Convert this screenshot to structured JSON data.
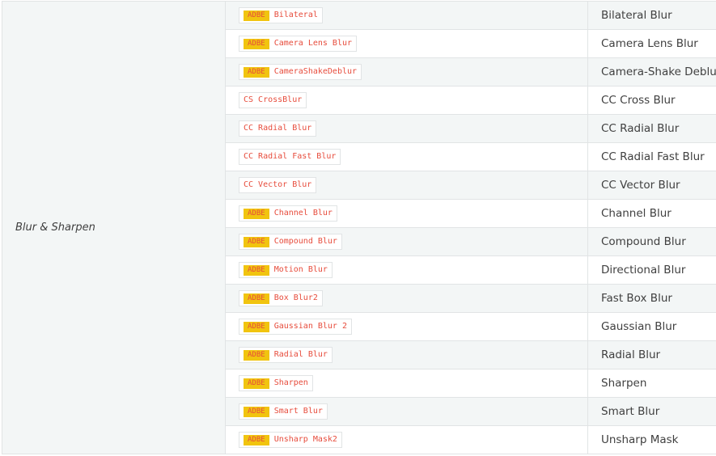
{
  "category": "Blur & Sharpen",
  "rows": [
    {
      "badge": "ADBE",
      "match": "Bilateral",
      "name": "Bilateral Blur"
    },
    {
      "badge": "ADBE",
      "match": "Camera Lens Blur",
      "name": "Camera Lens Blur"
    },
    {
      "badge": "ADBE",
      "match": "CameraShakeDeblur",
      "name": "Camera-Shake Deblur"
    },
    {
      "badge": "",
      "match": "CS CrossBlur",
      "name": "CC Cross Blur"
    },
    {
      "badge": "",
      "match": "CC Radial Blur",
      "name": "CC Radial Blur"
    },
    {
      "badge": "",
      "match": "CC Radial Fast Blur",
      "name": "CC Radial Fast Blur"
    },
    {
      "badge": "",
      "match": "CC Vector Blur",
      "name": "CC Vector Blur"
    },
    {
      "badge": "ADBE",
      "match": "Channel Blur",
      "name": "Channel Blur"
    },
    {
      "badge": "ADBE",
      "match": "Compound Blur",
      "name": "Compound Blur"
    },
    {
      "badge": "ADBE",
      "match": "Motion Blur",
      "name": "Directional Blur"
    },
    {
      "badge": "ADBE",
      "match": "Box Blur2",
      "name": "Fast Box Blur"
    },
    {
      "badge": "ADBE",
      "match": "Gaussian Blur 2",
      "name": "Gaussian Blur"
    },
    {
      "badge": "ADBE",
      "match": "Radial Blur",
      "name": "Radial Blur"
    },
    {
      "badge": "ADBE",
      "match": "Sharpen",
      "name": "Sharpen"
    },
    {
      "badge": "ADBE",
      "match": "Smart Blur",
      "name": "Smart Blur"
    },
    {
      "badge": "ADBE",
      "match": "Unsharp Mask2",
      "name": "Unsharp Mask"
    }
  ],
  "colors": {
    "badge_background": "#f1c40f",
    "code_text": "#e74c3c",
    "row_alt_background": "#f3f6f6",
    "border": "#e1e4e5",
    "text": "#404040"
  }
}
